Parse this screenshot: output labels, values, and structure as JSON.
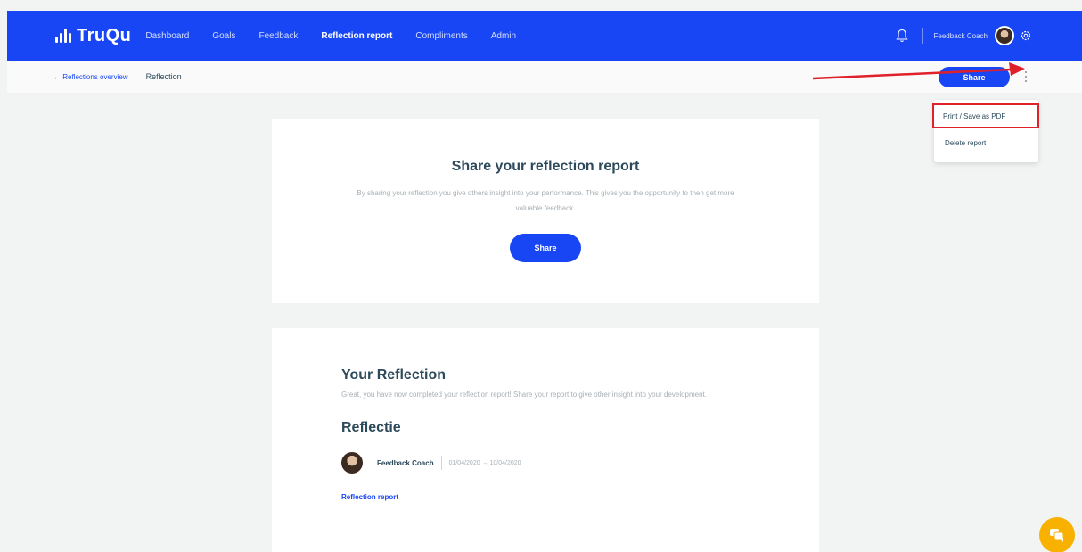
{
  "app": {
    "name": "TruQu"
  },
  "nav": {
    "items": [
      {
        "label": "Dashboard"
      },
      {
        "label": "Goals"
      },
      {
        "label": "Feedback"
      },
      {
        "label": "Reflection report"
      },
      {
        "label": "Compliments"
      },
      {
        "label": "Admin"
      }
    ],
    "active": "Reflection report"
  },
  "user": {
    "name": "Feedback Coach"
  },
  "breadcrumb": {
    "back": "← Reflections overview",
    "current": "Reflection"
  },
  "toolbar": {
    "share_label": "Share"
  },
  "menu": {
    "items": [
      {
        "label": "Print / Save as PDF"
      },
      {
        "label": "Delete report"
      }
    ]
  },
  "share_card": {
    "title": "Share your reflection report",
    "description": "By sharing your reflection you give others insight into your performance. This gives you the opportunity to then get more valuable feedback.",
    "button_label": "Share"
  },
  "reflection_card": {
    "title": "Your Reflection",
    "description": "Great, you have now completed your reflection report! Share your report to give other insight into your development.",
    "subtitle": "Reflectie",
    "author": "Feedback Coach",
    "date_range": "01/04/2020 → 10/04/2020",
    "tag": "Reflection report"
  },
  "colors": {
    "primary": "#1846f5",
    "annotation": "#e0202b",
    "chat": "#f9b100"
  },
  "icons": [
    "bell-icon",
    "gear-icon",
    "kebab-menu-icon",
    "chat-icon",
    "arrow-annotation"
  ]
}
